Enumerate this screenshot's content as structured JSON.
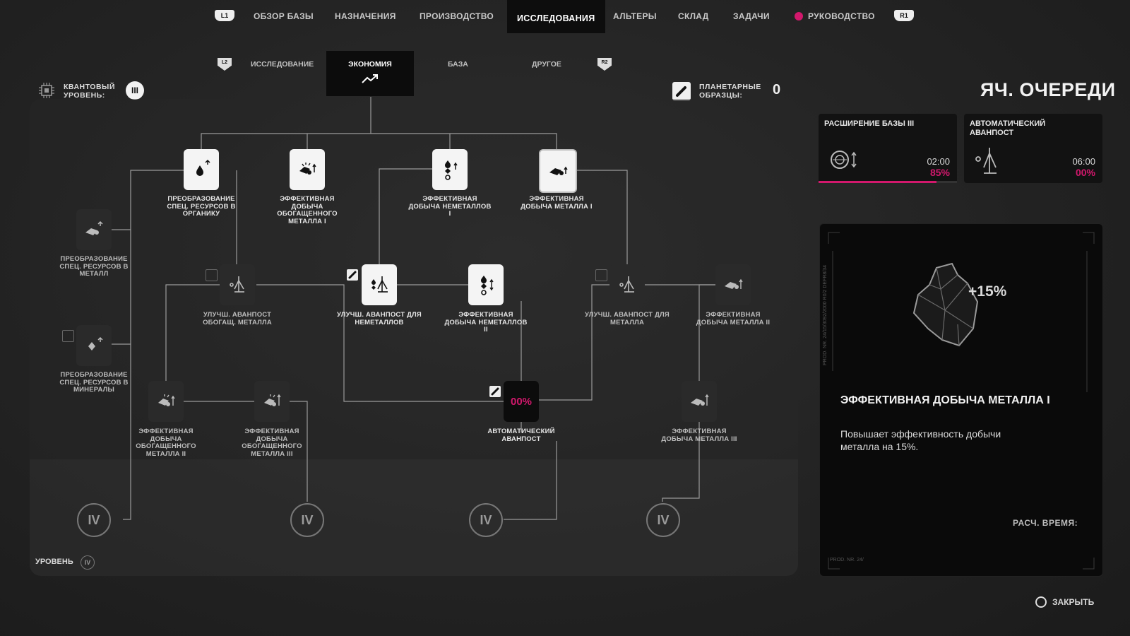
{
  "nav": {
    "l1": "L1",
    "r1": "R1",
    "tabs": [
      "ОБЗОР БАЗЫ",
      "НАЗНАЧЕНИЯ",
      "ПРОИЗВОДСТВО",
      "ИССЛЕДОВАНИЯ",
      "АЛЬТЕРЫ",
      "СКЛАД",
      "ЗАДАЧИ",
      "РУКОВОДСТВО"
    ],
    "active": "ИССЛЕДОВАНИЯ"
  },
  "subnav": {
    "l2": "L2",
    "r2": "R2",
    "tabs": [
      "ИССЛЕДОВАНИЕ",
      "ЭКОНОМИЯ",
      "БАЗА",
      "ДРУГОЕ"
    ],
    "active": "ЭКОНОМИЯ"
  },
  "quantum": {
    "label": "КВАНТОВЫЙ УРОВЕНЬ:",
    "value": "III"
  },
  "samples": {
    "label": "ПЛАНЕТАРНЫЕ ОБРАЗЦЫ:",
    "value": "0"
  },
  "queue": {
    "title": "ЯЧ. ОЧЕРЕДИ",
    "items": [
      {
        "name": "РАСШИРЕНИЕ БАЗЫ III",
        "time": "02:00",
        "percent": "85%",
        "progress": 0.85
      },
      {
        "name": "АВТОМАТИЧЕСКИЙ АВАНПОСТ",
        "time": "06:00",
        "percent": "00%",
        "progress": 0.0
      }
    ]
  },
  "tree": {
    "nodes": {
      "n1": "ПРЕОБРАЗОВАНИЕ СПЕЦ. РЕСУРСОВ В ОРГАНИКУ",
      "n2": "ЭФФЕКТИВНАЯ ДОБЫЧА ОБОГАЩЕННОГО МЕТАЛЛА I",
      "n3": "ЭФФЕКТИВНАЯ ДОБЫЧА НЕМЕТАЛЛОВ I",
      "n4": "ЭФФЕКТИВНАЯ ДОБЫЧА МЕТАЛЛА I",
      "n5": "ПРЕОБРАЗОВАНИЕ СПЕЦ. РЕСУРСОВ В МЕТАЛЛ",
      "n6": "ПРЕОБРАЗОВАНИЕ СПЕЦ. РЕСУРСОВ В МИНЕРАЛЫ",
      "n7": "УЛУЧШ. АВАНПОСТ ОБОГАЩ. МЕТАЛЛА",
      "n8": "УЛУЧШ. АВАНПОСТ ДЛЯ НЕМЕТАЛЛОВ",
      "n9": "ЭФФЕКТИВНАЯ ДОБЫЧА НЕМЕТАЛЛОВ II",
      "n10": "УЛУЧШ. АВАНПОСТ ДЛЯ МЕТАЛЛА",
      "n11": "ЭФФЕКТИВНАЯ ДОБЫЧА МЕТАЛЛА II",
      "n12": "ЭФФЕКТИВНАЯ ДОБЫЧА ОБОГАЩЕННОГО МЕТАЛЛА II",
      "n13": "ЭФФЕКТИВНАЯ ДОБЫЧА ОБОГАЩЕННОГО МЕТАЛЛА III",
      "n14": "АВТОМАТИЧЕСКИЙ АВАНПОСТ",
      "n15": "ЭФФЕКТИВНАЯ ДОБЫЧА МЕТАЛЛА III"
    },
    "autopost_percent": "00%",
    "tier_marker": "IV",
    "level_label": "УРОВЕНЬ",
    "level_value": "IV"
  },
  "detail": {
    "bonus": "+15%",
    "title": "ЭФФЕКТИВНАЯ ДОБЫЧА МЕТАЛЛА I",
    "description": "Повышает эффективность добычи металла на 15%.",
    "time_label": "РАСЧ. ВРЕМЯ:",
    "serial_vertical": "PROD. NR. 24/15/3092/2000 R0/2 DEFR8/34",
    "serial_bottom": "PROD. NR. 24/"
  },
  "close": {
    "label": "ЗАКРЫТЬ"
  },
  "colors": {
    "accent": "#d2186c",
    "background": "#232323",
    "panel": "#0a0a0a"
  }
}
